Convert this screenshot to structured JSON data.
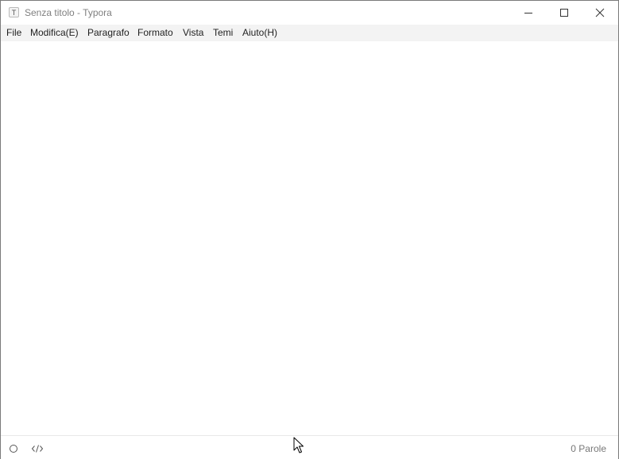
{
  "window": {
    "title": "Senza titolo - Typora",
    "app_icon_glyph": "T"
  },
  "menu": {
    "items": [
      {
        "label": "File"
      },
      {
        "label": "Modifica(E)"
      },
      {
        "label": "Paragrafo"
      },
      {
        "label": "Formato"
      },
      {
        "label": "Vista"
      },
      {
        "label": "Temi"
      },
      {
        "label": "Aiuto(H)"
      }
    ]
  },
  "statusbar": {
    "word_count": "0 Parole",
    "outline_icon": "circle-icon",
    "source_icon": "code-icon"
  },
  "colors": {
    "menubar_bg": "#f3f3f3",
    "title_text": "#7f7f7f",
    "status_text": "#777777"
  }
}
